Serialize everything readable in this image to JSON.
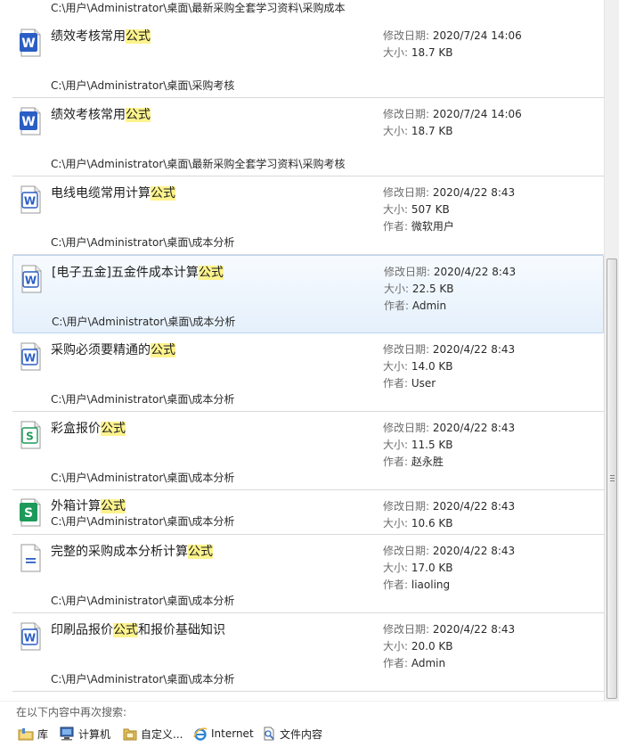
{
  "top_partial_path": "C:\\用户\\Administrator\\桌面\\最新采购全套学习资料\\采购成本",
  "labels": {
    "modified": "修改日期:",
    "size": "大小:",
    "author": "作者:"
  },
  "results": [
    {
      "icon": "word-doc-icon",
      "name_before": "绩效考核常用",
      "name_match": "公式",
      "name_after": "",
      "modified": "2020/7/24 14:06",
      "size": "18.7 KB",
      "author": null,
      "path": "C:\\用户\\Administrator\\桌面\\采购考核"
    },
    {
      "icon": "word-doc-icon",
      "name_before": "绩效考核常用",
      "name_match": "公式",
      "name_after": "",
      "modified": "2020/7/24 14:06",
      "size": "18.7 KB",
      "author": null,
      "path": "C:\\用户\\Administrator\\桌面\\最新采购全套学习资料\\采购考核"
    },
    {
      "icon": "word-doc-outline-icon",
      "name_before": "电线电缆常用计算",
      "name_match": "公式",
      "name_after": "",
      "modified": "2020/4/22 8:43",
      "size": "507 KB",
      "author": "微软用户",
      "path": "C:\\用户\\Administrator\\桌面\\成本分析"
    },
    {
      "icon": "word-doc-outline-icon",
      "name_before": "[电子五金]五金件成本计算",
      "name_match": "公式",
      "name_after": "",
      "modified": "2020/4/22 8:43",
      "size": "22.5 KB",
      "author": "Admin",
      "path": "C:\\用户\\Administrator\\桌面\\成本分析",
      "selected": true
    },
    {
      "icon": "word-doc-outline-icon",
      "name_before": "采购必须要精通的",
      "name_match": "公式",
      "name_after": "",
      "modified": "2020/4/22 8:43",
      "size": "14.0 KB",
      "author": "User",
      "path": "C:\\用户\\Administrator\\桌面\\成本分析"
    },
    {
      "icon": "spreadsheet-outline-icon",
      "name_before": "彩盒报价",
      "name_match": "公式",
      "name_after": "",
      "modified": "2020/4/22 8:43",
      "size": "11.5 KB",
      "author": "赵永胜",
      "path": "C:\\用户\\Administrator\\桌面\\成本分析"
    },
    {
      "icon": "spreadsheet-icon",
      "name_before": "外箱计算",
      "name_match": "公式",
      "name_after": "",
      "modified": "2020/4/22 8:43",
      "size": "10.6 KB",
      "author": null,
      "path": "C:\\用户\\Administrator\\桌面\\成本分析"
    },
    {
      "icon": "generic-doc-icon",
      "name_before": "完整的采购成本分析计算",
      "name_match": "公式",
      "name_after": "",
      "modified": "2020/4/22 8:43",
      "size": "17.0 KB",
      "author": "liaoling",
      "path": "C:\\用户\\Administrator\\桌面\\成本分析"
    },
    {
      "icon": "word-doc-outline-icon",
      "name_before": "印刷品报价",
      "name_match": "公式",
      "name_after": "和报价基础知识",
      "modified": "2020/4/22 8:43",
      "size": "20.0 KB",
      "author": "Admin",
      "path": "C:\\用户\\Administrator\\桌面\\成本分析"
    }
  ],
  "search_again": {
    "title": "在以下内容中再次搜索:",
    "items": [
      {
        "icon": "library-icon",
        "label": "库"
      },
      {
        "icon": "computer-icon",
        "label": "计算机"
      },
      {
        "icon": "custom-folder-icon",
        "label": "自定义..."
      },
      {
        "icon": "internet-explorer-icon",
        "label": "Internet"
      },
      {
        "icon": "file-contents-icon",
        "label": "文件内容"
      }
    ]
  },
  "colors": {
    "match_highlight": "#fdf38d",
    "word_blue": "#2b5ec4",
    "sheet_green": "#1d9a5a",
    "selection_border": "#bcd5ee"
  },
  "scroll_fraction": 0.37
}
